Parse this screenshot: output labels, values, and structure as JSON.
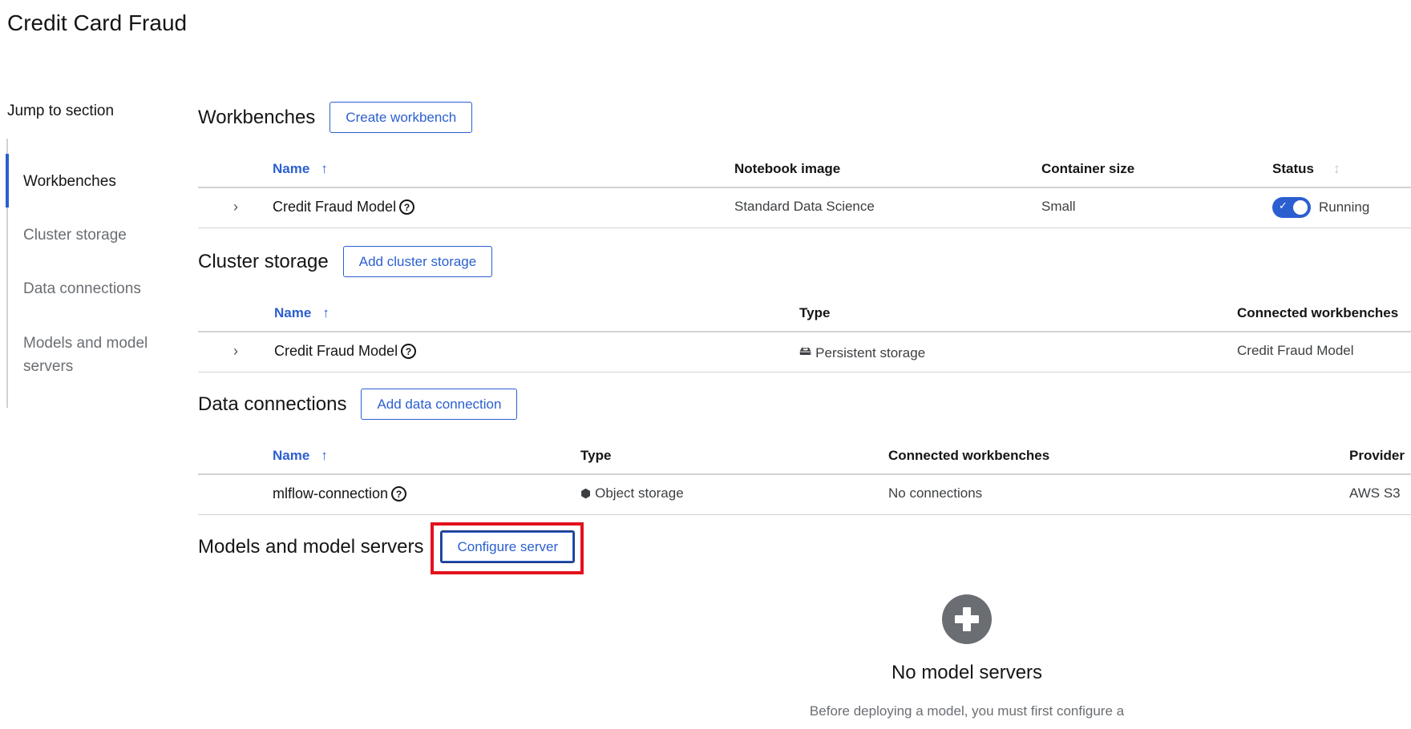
{
  "page": {
    "title": "Credit Card Fraud"
  },
  "jump": {
    "label": "Jump to section",
    "items": [
      {
        "label": "Workbenches",
        "active": true
      },
      {
        "label": "Cluster storage",
        "active": false
      },
      {
        "label": "Data connections",
        "active": false
      },
      {
        "label": "Models and model servers",
        "active": false
      }
    ]
  },
  "workbenches": {
    "title": "Workbenches",
    "button": "Create workbench",
    "columns": [
      "Name",
      "Notebook image",
      "Container size",
      "Status"
    ],
    "sort_icon": "↑",
    "status_sort_icon": "↕",
    "rows": [
      {
        "name": "Credit Fraud Model",
        "image": "Standard Data Science",
        "size": "Small",
        "status": "Running",
        "toggle_on": true
      }
    ]
  },
  "cluster_storage": {
    "title": "Cluster storage",
    "button": "Add cluster storage",
    "columns": [
      "Name",
      "Type",
      "Connected workbenches"
    ],
    "sort_icon": "↑",
    "rows": [
      {
        "name": "Credit Fraud Model",
        "type": "Persistent storage",
        "type_icon": "hard-drive-icon",
        "connected": "Credit Fraud Model"
      }
    ]
  },
  "data_connections": {
    "title": "Data connections",
    "button": "Add data connection",
    "columns": [
      "Name",
      "Type",
      "Connected workbenches",
      "Provider"
    ],
    "sort_icon": "↑",
    "rows": [
      {
        "name": "mlflow-connection",
        "type": "Object storage",
        "type_icon": "cube-icon",
        "connected": "No connections",
        "provider": "AWS S3"
      }
    ]
  },
  "models": {
    "title": "Models and model servers",
    "button": "Configure server",
    "empty_title": "No model servers",
    "empty_body": "Before deploying a model, you must first configure a"
  },
  "icons": {
    "help": "?",
    "expand": "›",
    "check": "✓",
    "drive": "🖴",
    "cube": "⬢"
  },
  "colors": {
    "accent": "#2b5fd0",
    "highlight": "#e3111d",
    "muted": "#6a6e73"
  }
}
